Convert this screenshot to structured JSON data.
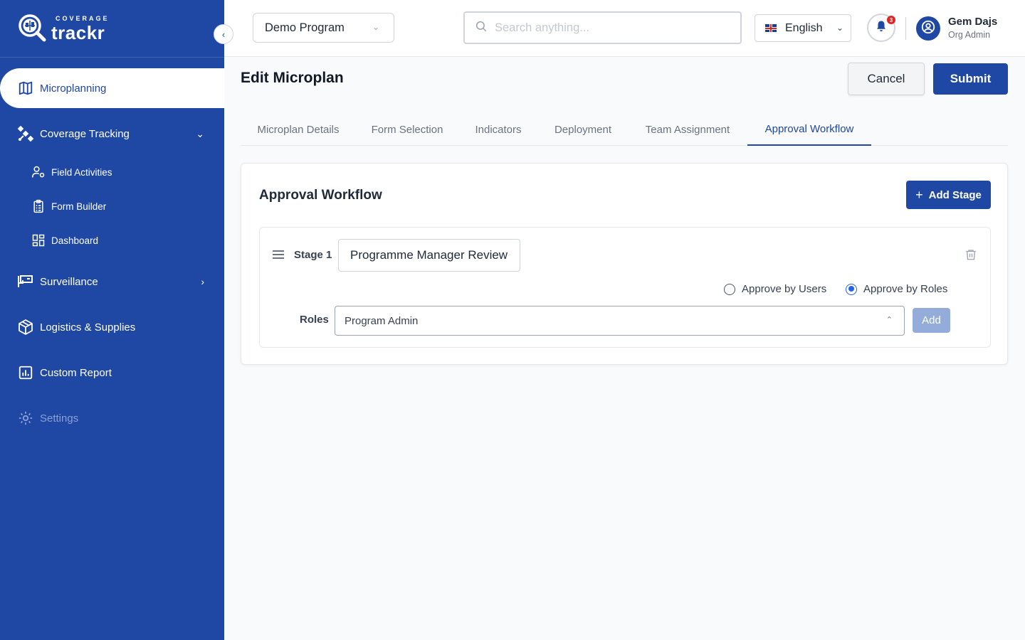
{
  "brand": {
    "small": "COVERAGE",
    "big": "trackr"
  },
  "sidebar": {
    "items": [
      {
        "label": "Microplanning"
      },
      {
        "label": "Coverage Tracking"
      },
      {
        "label": "Field Activities"
      },
      {
        "label": "Form Builder"
      },
      {
        "label": "Dashboard"
      },
      {
        "label": "Surveillance"
      },
      {
        "label": "Logistics & Supplies"
      },
      {
        "label": "Custom Report"
      },
      {
        "label": "Settings"
      }
    ]
  },
  "header": {
    "program": "Demo Program",
    "search_placeholder": "Search anything...",
    "language": "English",
    "notification_count": "3",
    "user_name": "Gem Dajs",
    "user_role": "Org Admin"
  },
  "page": {
    "title": "Edit Microplan",
    "cancel_label": "Cancel",
    "submit_label": "Submit"
  },
  "tabs": [
    {
      "label": "Microplan Details"
    },
    {
      "label": "Form Selection"
    },
    {
      "label": "Indicators"
    },
    {
      "label": "Deployment"
    },
    {
      "label": "Team Assignment"
    },
    {
      "label": "Approval Workflow",
      "active": true
    }
  ],
  "workflow": {
    "title": "Approval Workflow",
    "add_stage_label": "Add Stage",
    "stage": {
      "label": "Stage 1",
      "name_value": "Programme Manager Review",
      "radio_users": "Approve by Users",
      "radio_roles": "Approve by Roles",
      "selected": "roles",
      "roles_label": "Roles",
      "roles_value": "Program Admin",
      "add_label": "Add"
    }
  },
  "colors": {
    "primary": "#1f47a4",
    "accent": "#2563eb",
    "badge": "#dc2626"
  }
}
